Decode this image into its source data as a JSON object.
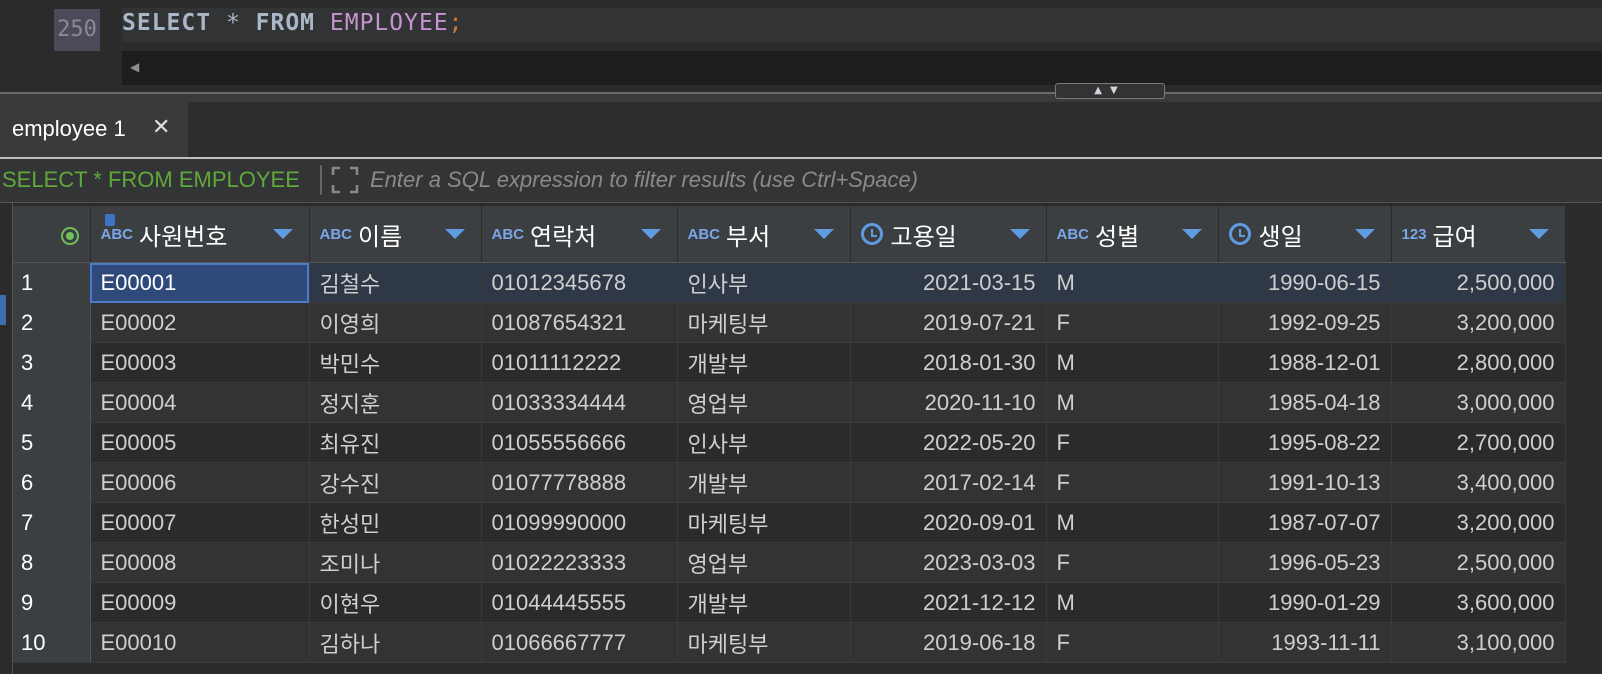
{
  "editor": {
    "line_number": "250",
    "sql": {
      "kw1": "SELECT",
      "star": " * ",
      "kw2": "FROM",
      "table": " EMPLOYEE",
      "semi": ";"
    }
  },
  "tab": {
    "label": "employee 1",
    "close": "✕"
  },
  "filter": {
    "query": "SELECT * FROM EMPLOYEE",
    "placeholder": "Enter a SQL expression to filter results (use Ctrl+Space)"
  },
  "columns": [
    {
      "type": "ABC",
      "name": "사원번호",
      "icon": "text-key-icon"
    },
    {
      "type": "ABC",
      "name": "이름",
      "icon": "text-type-icon"
    },
    {
      "type": "ABC",
      "name": "연락처",
      "icon": "text-type-icon"
    },
    {
      "type": "ABC",
      "name": "부서",
      "icon": "text-type-icon"
    },
    {
      "type": "",
      "name": "고용일",
      "icon": "clock-icon"
    },
    {
      "type": "ABC",
      "name": "성별",
      "icon": "text-type-icon"
    },
    {
      "type": "",
      "name": "생일",
      "icon": "clock-icon"
    },
    {
      "type": "123",
      "name": "급여",
      "icon": "number-type-icon"
    }
  ],
  "rows": [
    {
      "n": "1",
      "cells": [
        "E00001",
        "김철수",
        "01012345678",
        "인사부",
        "2021-03-15",
        "M",
        "1990-06-15",
        "2,500,000"
      ]
    },
    {
      "n": "2",
      "cells": [
        "E00002",
        "이영희",
        "01087654321",
        "마케팅부",
        "2019-07-21",
        "F",
        "1992-09-25",
        "3,200,000"
      ]
    },
    {
      "n": "3",
      "cells": [
        "E00003",
        "박민수",
        "01011112222",
        "개발부",
        "2018-01-30",
        "M",
        "1988-12-01",
        "2,800,000"
      ]
    },
    {
      "n": "4",
      "cells": [
        "E00004",
        "정지훈",
        "01033334444",
        "영업부",
        "2020-11-10",
        "M",
        "1985-04-18",
        "3,000,000"
      ]
    },
    {
      "n": "5",
      "cells": [
        "E00005",
        "최유진",
        "01055556666",
        "인사부",
        "2022-05-20",
        "F",
        "1995-08-22",
        "2,700,000"
      ]
    },
    {
      "n": "6",
      "cells": [
        "E00006",
        "강수진",
        "01077778888",
        "개발부",
        "2017-02-14",
        "F",
        "1991-10-13",
        "3,400,000"
      ]
    },
    {
      "n": "7",
      "cells": [
        "E00007",
        "한성민",
        "01099990000",
        "마케팅부",
        "2020-09-01",
        "M",
        "1987-07-07",
        "3,200,000"
      ]
    },
    {
      "n": "8",
      "cells": [
        "E00008",
        "조미나",
        "01022223333",
        "영업부",
        "2023-03-03",
        "F",
        "1996-05-23",
        "2,500,000"
      ]
    },
    {
      "n": "9",
      "cells": [
        "E00009",
        "이현우",
        "01044445555",
        "개발부",
        "2021-12-12",
        "M",
        "1990-01-29",
        "3,600,000"
      ]
    },
    {
      "n": "10",
      "cells": [
        "E00010",
        "김하나",
        "01066667777",
        "마케팅부",
        "2019-06-18",
        "F",
        "1993-11-11",
        "3,100,000"
      ]
    }
  ],
  "colors": {
    "accent": "#5f9be0",
    "query_green": "#5fa93b",
    "selection": "#2f4a7a"
  }
}
